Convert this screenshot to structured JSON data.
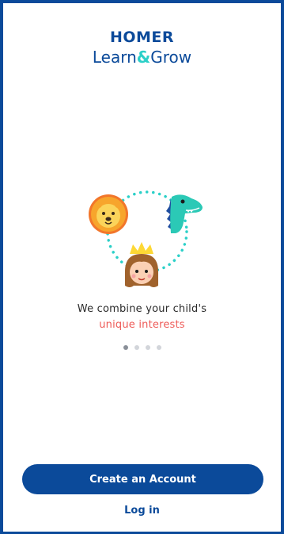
{
  "logo": {
    "brand": "HOMER",
    "tagline_part1": "Learn",
    "tagline_amp": "&",
    "tagline_part2": "Grow"
  },
  "illustration": {
    "characters": [
      "lion-icon",
      "dinosaur-icon",
      "princess-icon"
    ]
  },
  "onboarding": {
    "line1": "We combine your child's",
    "line2": "unique interests",
    "pagination": {
      "total": 4,
      "active_index": 0
    }
  },
  "actions": {
    "create_account_label": "Create an Account",
    "login_label": "Log in"
  },
  "colors": {
    "brand_blue": "#0b4a9a",
    "accent_teal": "#2bd0c8",
    "highlight_red": "#ee5a57"
  }
}
